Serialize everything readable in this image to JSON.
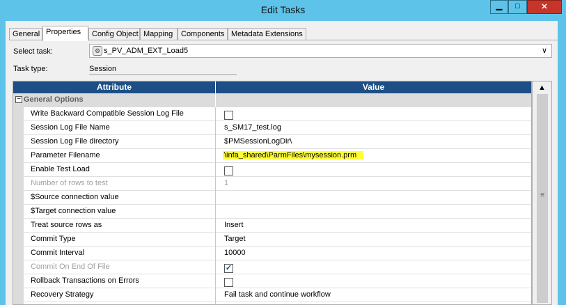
{
  "window": {
    "title": "Edit Tasks",
    "min_glyph": "▁",
    "max_glyph": "□",
    "close_glyph": "✕"
  },
  "tabs": [
    {
      "label": "General",
      "active": false
    },
    {
      "label": "Properties",
      "active": true
    },
    {
      "label": "Config Object",
      "active": false
    },
    {
      "label": "Mapping",
      "active": false
    },
    {
      "label": "Components",
      "active": false
    },
    {
      "label": "Metadata Extensions",
      "active": false
    }
  ],
  "select_task": {
    "label": "Select task:",
    "value": "s_PV_ADM_EXT_Load5",
    "icon": "gear-icon"
  },
  "task_type": {
    "label": "Task type:",
    "value": "Session"
  },
  "grid": {
    "col_attribute": "Attribute",
    "col_value": "Value",
    "group": "General Options",
    "group_toggle": "−",
    "rows": [
      {
        "attribute": "Write Backward Compatible Session Log File",
        "type": "checkbox",
        "checked": false,
        "disabled": false
      },
      {
        "attribute": "Session Log File Name",
        "type": "text",
        "value": "s_SM17_test.log",
        "disabled": false
      },
      {
        "attribute": "Session Log File directory",
        "type": "text",
        "value": "$PMSessionLogDir\\",
        "disabled": false
      },
      {
        "attribute": "Parameter Filename",
        "type": "text",
        "value": "\\infa_shared\\ParmFiles\\mysession.prm",
        "highlighted": true,
        "disabled": false
      },
      {
        "attribute": "Enable Test Load",
        "type": "checkbox",
        "checked": false,
        "disabled": false
      },
      {
        "attribute": "Number of rows to test",
        "type": "text",
        "value": "1",
        "disabled": true
      },
      {
        "attribute": "$Source connection value",
        "type": "text",
        "value": "",
        "disabled": false
      },
      {
        "attribute": "$Target connection value",
        "type": "text",
        "value": "",
        "disabled": false
      },
      {
        "attribute": "Treat source rows as",
        "type": "text",
        "value": "Insert",
        "disabled": false
      },
      {
        "attribute": "Commit Type",
        "type": "text",
        "value": "Target",
        "disabled": false
      },
      {
        "attribute": "Commit Interval",
        "type": "text",
        "value": "10000",
        "disabled": false
      },
      {
        "attribute": "Commit On End Of File",
        "type": "checkbox",
        "checked": true,
        "disabled": true
      },
      {
        "attribute": "Rollback Transactions on Errors",
        "type": "checkbox",
        "checked": false,
        "disabled": false
      },
      {
        "attribute": "Recovery Strategy",
        "type": "text",
        "value": "Fail task and continue workflow",
        "disabled": false
      }
    ]
  },
  "scrollbar": {
    "up_glyph": "▲",
    "grip_glyph": "≡"
  },
  "colors": {
    "title_bar": "#5ec3e8",
    "grid_header": "#1d4f86",
    "highlight": "#ffff33",
    "close_button": "#c7352a"
  }
}
